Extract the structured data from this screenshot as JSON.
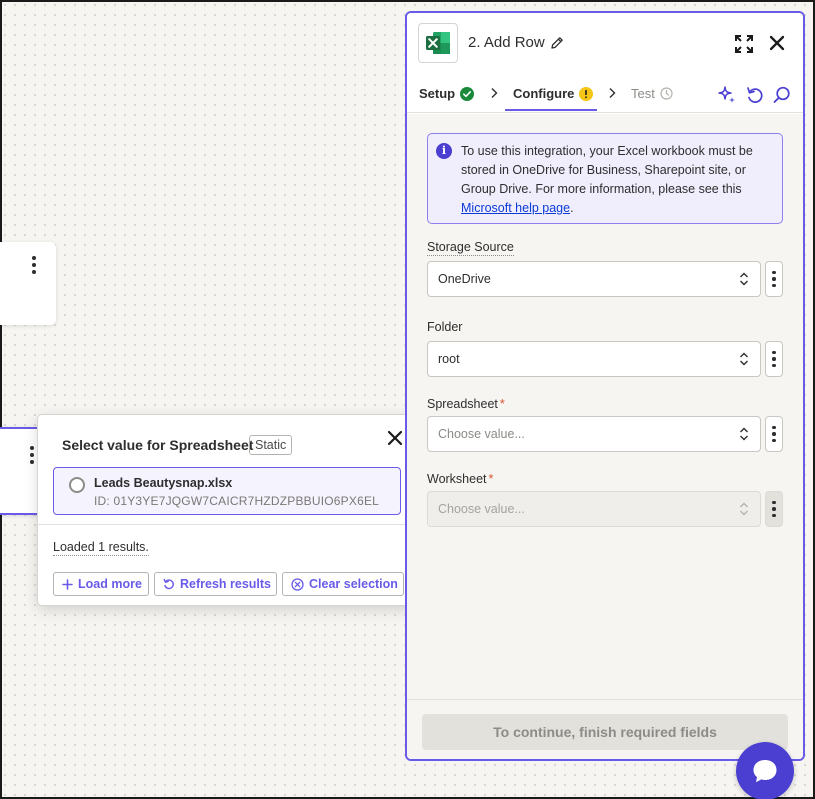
{
  "popover": {
    "title": "Select value for Spreadsheet",
    "badge": "Static",
    "option": {
      "name": "Leads Beautysnap.xlsx",
      "id": "ID: 01Y3YE7JQGW7CAICR7HZDZPBBUIO6PX6EL"
    },
    "loaded_text": "Loaded 1 results.",
    "load_more_label": "Load more",
    "refresh_label": "Refresh results",
    "clear_label": "Clear selection"
  },
  "panel": {
    "step_title": "2. Add Row",
    "tabs": {
      "setup": "Setup",
      "configure": "Configure",
      "test": "Test"
    },
    "info": {
      "text": "To use this integration, your Excel workbook must be stored in OneDrive for Business, Sharepoint site, or Group Drive. For more information, please see this ",
      "link": "Microsoft help page",
      "trailing": "."
    },
    "fields": {
      "storage_label": "Storage Source",
      "storage_value": "OneDrive",
      "folder_label": "Folder",
      "folder_value": "root",
      "spreadsheet_label": "Spreadsheet",
      "spreadsheet_placeholder": "Choose value...",
      "worksheet_label": "Worksheet",
      "worksheet_placeholder": "Choose value...",
      "required_mark": "*"
    },
    "continue_label": "To continue, finish required fields"
  },
  "colors": {
    "accent": "#695be8",
    "brand_dark": "#4a3fd0",
    "success": "#1a8a3a",
    "warning": "#f5c518",
    "link": "#0a3bd6",
    "excel_green": "#1d6f42"
  },
  "icons": [
    "excel-icon",
    "pencil-icon",
    "expand-icon",
    "close-icon",
    "check-circle-icon",
    "warning-icon",
    "clock-icon",
    "sparkle-icon",
    "undo-icon",
    "search-icon",
    "info-icon",
    "chat-icon",
    "plus-icon",
    "refresh-icon",
    "clear-icon"
  ]
}
